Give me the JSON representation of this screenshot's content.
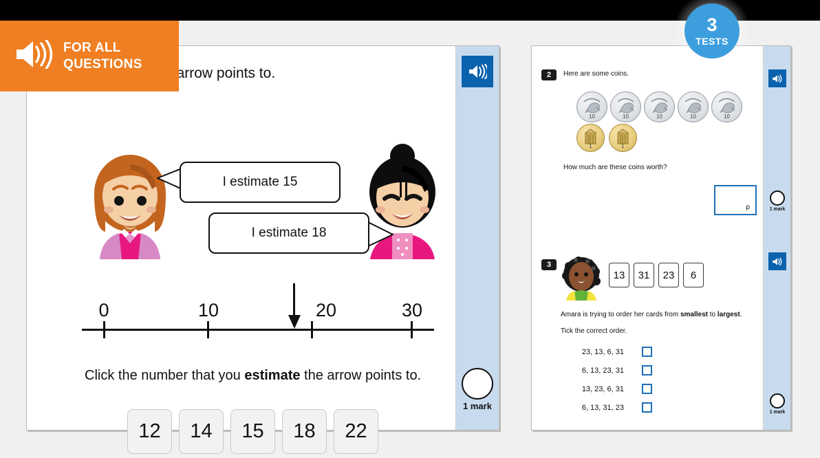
{
  "banner": {
    "line1": "FOR ALL",
    "line2": "QUESTIONS",
    "icon": "speaker-icon",
    "color": "#ef7f22"
  },
  "badge": {
    "number": "3",
    "label": "TESTS",
    "color": "#3d9ede"
  },
  "left_panel": {
    "question_text": "which number the arrow points to.",
    "bubble_left": "I estimate 15",
    "bubble_right": "I estimate 18",
    "number_line": {
      "ticks": [
        "0",
        "10",
        "20",
        "30"
      ],
      "arrow_value": 18
    },
    "instruction_prefix": "Click the number that you ",
    "instruction_bold": "estimate",
    "instruction_suffix": " the arrow points to.",
    "options": [
      "12",
      "14",
      "15",
      "18",
      "22"
    ],
    "audio_icon": "speaker-icon",
    "mark_label": "1 mark"
  },
  "right_panel": {
    "q2": {
      "number": "2",
      "prompt": "Here are some coins.",
      "coins_ten": [
        {
          "value": "10",
          "top_text": "TEN PENCE"
        },
        {
          "value": "10",
          "top_text": "TEN PENCE"
        },
        {
          "value": "10",
          "top_text": "TEN PENCE"
        },
        {
          "value": "10",
          "top_text": "TEN PENCE"
        },
        {
          "value": "10",
          "top_text": "TEN PENCE"
        }
      ],
      "coins_one": [
        {
          "value": "1",
          "top_text": "ONE PENNY"
        },
        {
          "value": "1",
          "top_text": "ONE PENNY"
        }
      ],
      "question": "How much are these coins worth?",
      "answer_value": "",
      "answer_unit": "p",
      "audio_icon": "speaker-icon",
      "mark_label": "1 mark"
    },
    "q3": {
      "number": "3",
      "avatar": "amara-avatar",
      "cards": [
        "13",
        "31",
        "23",
        "6"
      ],
      "sentence_prefix": "Amara is trying to order her cards from ",
      "sentence_bold1": "smallest",
      "sentence_mid": " to ",
      "sentence_bold2": "largest",
      "sentence_suffix": ".",
      "instruction": "Tick the correct order.",
      "choices": [
        "23, 13, 6, 31",
        "6, 13, 23, 31",
        "13, 23, 6, 31",
        "6, 13, 31, 23"
      ],
      "audio_icon": "speaker-icon",
      "mark_label": "1 mark"
    }
  }
}
